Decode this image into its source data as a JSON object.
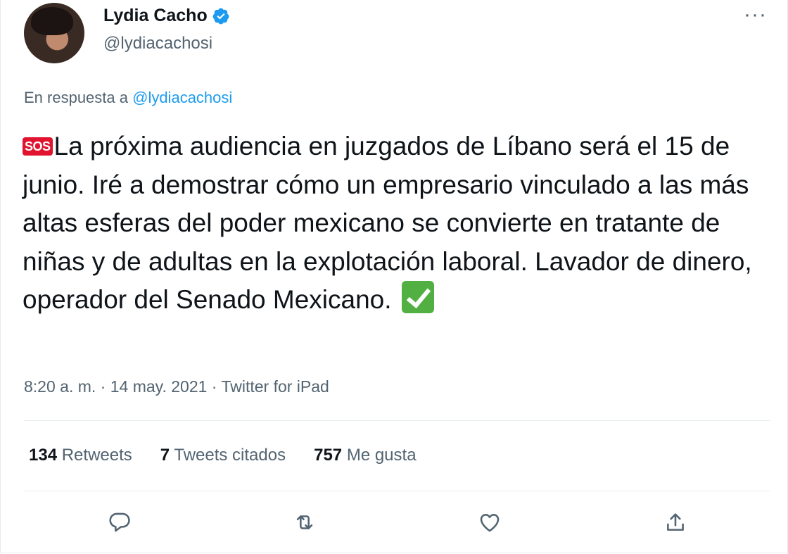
{
  "author": {
    "display_name": "Lydia Cacho",
    "handle": "@lydiacachosi",
    "verified": true
  },
  "reply_to": {
    "prefix": "En respuesta a",
    "mention": "@lydiacachosi"
  },
  "tweet": {
    "sos_emoji": "SOS",
    "text": "La próxima audiencia en juzgados de Líbano será el 15 de junio. Iré a demostrar cómo un empresario vinculado a las más altas esferas del poder mexicano se convierte en tratante de niñas y de adultas en la explotación laboral. Lavador de dinero, operador del Senado Mexicano.",
    "end_emoji": "check-mark-button"
  },
  "meta": {
    "time": "8:20 a. m.",
    "separator1": "·",
    "date": "14 may. 2021",
    "separator2": "·",
    "source": "Twitter for iPad"
  },
  "stats": [
    {
      "count": "134",
      "label": "Retweets"
    },
    {
      "count": "7",
      "label": "Tweets citados"
    },
    {
      "count": "757",
      "label": "Me gusta"
    }
  ],
  "more_glyph": "···",
  "colors": {
    "text": "#0f1419",
    "secondary": "#536471",
    "link": "#1d9bf0",
    "divider": "#e6ecf0"
  }
}
